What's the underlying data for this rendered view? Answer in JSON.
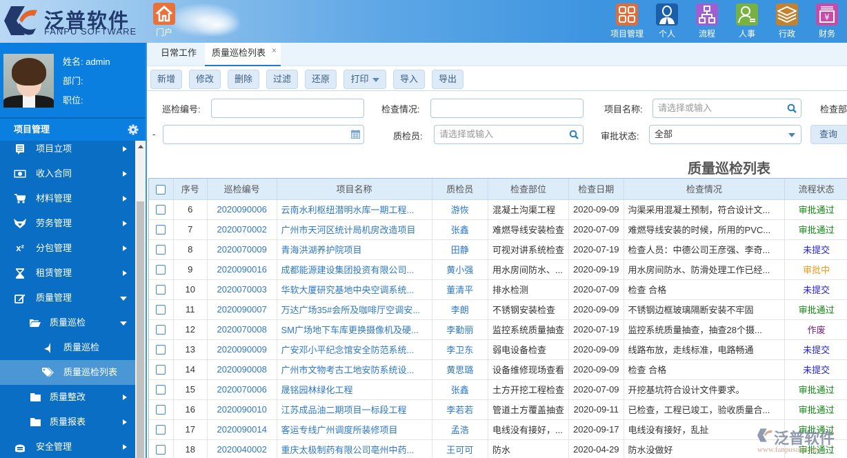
{
  "header": {
    "logo_cn": "泛普软件",
    "logo_en": "FANPU SOFTWARE",
    "portal_label": "门户",
    "modules": [
      {
        "label": "项目管理",
        "icon": "grid-icon",
        "color": "#e06c3a"
      },
      {
        "label": "个人",
        "icon": "person-icon",
        "color": "#1a5fa8"
      },
      {
        "label": "流程",
        "icon": "flowchart-icon",
        "color": "#a05fd0"
      },
      {
        "label": "人事",
        "icon": "user-list-icon",
        "color": "#77b13f"
      },
      {
        "label": "行政",
        "icon": "layers-icon",
        "color": "#c4812e"
      },
      {
        "label": "财务",
        "icon": "yen-icon",
        "color": "#c94aa9"
      }
    ]
  },
  "profile": {
    "name_label": "姓名: admin",
    "dept_label": "部门:",
    "position_label": "职位:"
  },
  "sidebar": {
    "section_title": "项目管理",
    "items": [
      {
        "label": "项目立项",
        "icon": "document-icon",
        "level": 1,
        "arrow": "right"
      },
      {
        "label": "收入合同",
        "icon": "money-icon",
        "level": 1,
        "arrow": "right"
      },
      {
        "label": "材料管理",
        "icon": "cart-icon",
        "level": 1,
        "arrow": "right"
      },
      {
        "label": "劳务管理",
        "icon": "fox-icon",
        "level": 1,
        "arrow": "right"
      },
      {
        "label": "分包管理",
        "icon": "superscript-icon",
        "level": 1,
        "arrow": "right"
      },
      {
        "label": "租赁管理",
        "icon": "hourglass-icon",
        "level": 1,
        "arrow": "right"
      },
      {
        "label": "质量管理",
        "icon": "edit-icon",
        "level": 1,
        "arrow": "down"
      },
      {
        "label": "质量巡检",
        "icon": "folder-open-icon",
        "level": 2,
        "arrow": "down"
      },
      {
        "label": "质量巡检",
        "icon": "flag-icon",
        "level": 3,
        "arrow": ""
      },
      {
        "label": "质量巡检列表",
        "icon": "tag-icon",
        "level": 3,
        "arrow": "",
        "active": true
      },
      {
        "label": "质量整改",
        "icon": "folder-icon",
        "level": 2,
        "arrow": "right"
      },
      {
        "label": "质量报表",
        "icon": "folder-icon",
        "level": 2,
        "arrow": "right"
      },
      {
        "label": "安全管理",
        "icon": "helmet-icon",
        "level": 1,
        "arrow": "right"
      }
    ]
  },
  "tabs": [
    {
      "label": "日常工作"
    },
    {
      "label": "质量巡检列表",
      "active": true,
      "close": "×"
    }
  ],
  "toolbar": {
    "add": "新增",
    "edit": "修改",
    "delete": "删除",
    "filter": "过滤",
    "reset": "还原",
    "print": "打印",
    "import": "导入",
    "export": "导出"
  },
  "filters": {
    "inspection_no_label": "巡检编号:",
    "inspection_no_value": "",
    "check_status_label": "检查情况:",
    "check_status_value": "",
    "project_name_label": "项目名称:",
    "project_name_placeholder": "请选择或输入",
    "check_dept_label": "检查部",
    "date_separator": "-",
    "date_value": "",
    "inspector_label": "质检员:",
    "inspector_placeholder": "请选择或输入",
    "approval_label": "审批状态:",
    "approval_value": "全部",
    "query_button": "查询"
  },
  "page_title": "质量巡检列表",
  "table": {
    "columns": [
      "",
      "序号",
      "巡检编号",
      "项目名称",
      "质检员",
      "检查部位",
      "检查日期",
      "检查情况",
      "流程状态"
    ],
    "rows": [
      {
        "no": "6",
        "code": "2020090006",
        "project": "云南水利枢纽潜明水库一期工程...",
        "inspector": "游恢",
        "part": "混凝土沟渠工程",
        "date": "2020-09-09",
        "status_text": "沟渠采用混凝土预制，符合设计文...",
        "flow": "审批通过",
        "flow_type": "pass"
      },
      {
        "no": "7",
        "code": "2020070002",
        "project": "广州市天河区统计局机房改造项目",
        "inspector": "张鑫",
        "part": "难燃导线安装检查",
        "date": "2020-07-09",
        "status_text": "难燃导线安装的时候，所用的PVC...",
        "flow": "审批通过",
        "flow_type": "pass"
      },
      {
        "no": "8",
        "code": "2020070009",
        "project": "青海洪湖养护院项目",
        "inspector": "田静",
        "part": "可视对讲系统检查",
        "date": "2020-07-19",
        "status_text": "检查人员：中德公司王彦强、李奇...",
        "flow": "未提交",
        "flow_type": "unsub"
      },
      {
        "no": "9",
        "code": "2020090016",
        "project": "成都能源建设集团投资有限公司...",
        "inspector": "黄小强",
        "part": "用水房间防水、...",
        "date": "2020-09-19",
        "status_text": "用水房间防水、防滑处理工作已经...",
        "flow": "审批中",
        "flow_type": "pending"
      },
      {
        "no": "10",
        "code": "2020070003",
        "project": "华软大厦研究基地中央空调系统...",
        "inspector": "董清平",
        "part": "排水检测",
        "date": "2020-07-09",
        "status_text": "检查 合格",
        "flow": "未提交",
        "flow_type": "unsub"
      },
      {
        "no": "11",
        "code": "2020090007",
        "project": "万达广场35#会所及咖啡厅空调安...",
        "inspector": "李朗",
        "part": "不锈钢安装检查",
        "date": "2020-09-09",
        "status_text": "不锈钢边框玻璃隔断安装不牢固",
        "flow": "审批通过",
        "flow_type": "pass"
      },
      {
        "no": "12",
        "code": "2020070008",
        "project": "SM广场地下车库更换摄像机及硬...",
        "inspector": "李勤丽",
        "part": "监控系统质量抽查",
        "date": "2020-07-19",
        "status_text": "监控系统质量抽查，抽查28个摄...",
        "flow": "作废",
        "flow_type": "void"
      },
      {
        "no": "13",
        "code": "2020090009",
        "project": "广安邓小平纪念馆安全防范系统...",
        "inspector": "李卫东",
        "part": "弱电设备检查",
        "date": "2020-09-09",
        "status_text": "线路布放，走线标准，电路畅通",
        "flow": "未提交",
        "flow_type": "unsub"
      },
      {
        "no": "14",
        "code": "2020090008",
        "project": "广州市文物考古工地安防系统设...",
        "inspector": "黄思璐",
        "part": "设备维修现场查看",
        "date": "2020-09-09",
        "status_text": "检查 合格",
        "flow": "未提交",
        "flow_type": "unsub"
      },
      {
        "no": "15",
        "code": "2020070006",
        "project": "晟铭园林绿化工程",
        "inspector": "张鑫",
        "part": "土方开挖工程检查",
        "date": "2020-07-09",
        "status_text": "开挖基坑符合设计文件要求。",
        "flow": "审批通过",
        "flow_type": "pass"
      },
      {
        "no": "16",
        "code": "2020090010",
        "project": "江苏成品油二期项目一标段工程",
        "inspector": "李若若",
        "part": "管道土方覆盖抽查",
        "date": "2020-09-11",
        "status_text": "已检查，工程已竣工，验收质量合...",
        "flow": "审批通过",
        "flow_type": "pass"
      },
      {
        "no": "17",
        "code": "2020090014",
        "project": "客运专线广州调度所装修项目",
        "inspector": "孟浩",
        "part": "电线没有接好，...",
        "date": "2020-09-17",
        "status_text": "电线没有接好，乱扯",
        "flow": "审批通过",
        "flow_type": "pass"
      },
      {
        "no": "18",
        "code": "2020040002",
        "project": "重庆太极制药有限公司亳州中药...",
        "inspector": "王可可",
        "part": "防水",
        "date": "2020-04-29",
        "status_text": "防水没做好",
        "flow": "审批通过",
        "flow_type": "pass"
      }
    ]
  },
  "watermark": {
    "cn": "泛普软件",
    "url": "www.fanpusoft.com"
  },
  "colors": {
    "sidebar_bg": "#0a6ec4",
    "header_blue": "#3a93df",
    "link": "#2e78c7",
    "status_pass": "#138a13",
    "status_unsubmitted": "#2323d6",
    "status_pending": "#f09a1a",
    "status_void": "#7d1b8f"
  }
}
